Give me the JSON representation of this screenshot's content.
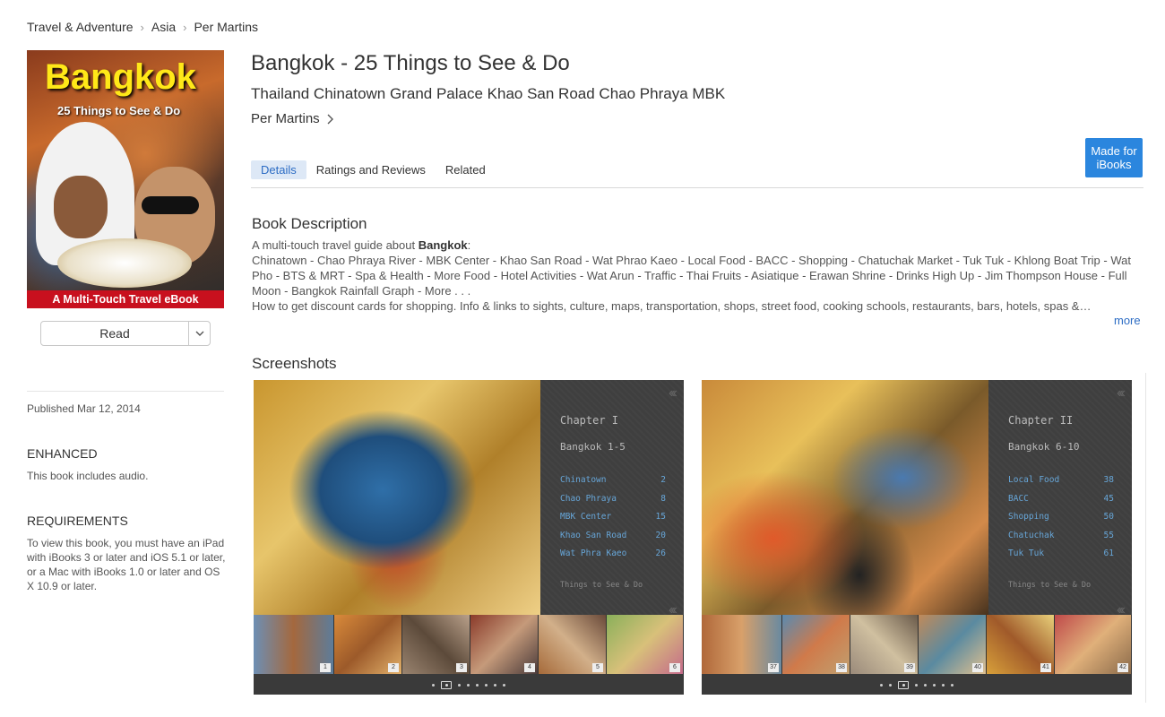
{
  "breadcrumb": [
    "Travel & Adventure",
    "Asia",
    "Per Martins"
  ],
  "cover": {
    "title": "Bangkok",
    "subtitle": "25 Things to See & Do",
    "banner": "A Multi-Touch Travel eBook"
  },
  "read_button": {
    "label": "Read",
    "icon": "chevron-down-icon"
  },
  "sidebar": {
    "published": "Published Mar 12, 2014",
    "enhanced_heading": "ENHANCED",
    "enhanced_text": "This book includes audio.",
    "requirements_heading": "REQUIREMENTS",
    "requirements_text": "To view this book, you must have an iPad with iBooks 3 or later and iOS 5.1 or later, or a Mac with iBooks 1.0 or later and OS X 10.9 or later."
  },
  "book": {
    "title": "Bangkok - 25 Things to See & Do",
    "subtitle": "Thailand Chinatown Grand Palace Khao San Road Chao Phraya MBK",
    "author": "Per Martins"
  },
  "badge": {
    "line1": "Made for",
    "line2": "iBooks"
  },
  "tabs": [
    {
      "label": "Details",
      "active": true
    },
    {
      "label": "Ratings and Reviews",
      "active": false
    },
    {
      "label": "Related",
      "active": false
    }
  ],
  "description": {
    "heading": "Book Description",
    "intro_prefix": "A multi-touch travel guide about ",
    "intro_bold": "Bangkok",
    "intro_suffix": ":",
    "body": "Chinatown - Chao Phraya River - MBK Center - Khao San Road - Wat Phrao Kaeo - Local Food - BACC - Shopping - Chatuchak Market - Tuk Tuk - Khlong Boat Trip - Wat Pho - BTS & MRT - Spa & Health - More Food - Hotel Activities - Wat Arun - Traffic - Thai Fruits - Asiatique - Erawan Shrine - Drinks High Up - Jim Thompson House - Full Moon - Bangkok Rainfall Graph - More . . .",
    "body2": "How to get discount cards for shopping. Info & links to sights, culture, maps, transportation, shops, street food, cooking schools, restaurants, bars, hotels, spas &…",
    "more": "more"
  },
  "screenshots": {
    "heading": "Screenshots",
    "items": [
      {
        "chapter": "Chapter I",
        "range": "Bangkok 1-5",
        "toc": [
          {
            "name": "Chinatown",
            "page": "2"
          },
          {
            "name": "Chao Phraya",
            "page": "8"
          },
          {
            "name": "MBK Center",
            "page": "15"
          },
          {
            "name": "Khao San Road",
            "page": "20"
          },
          {
            "name": "Wat Phra Kaeo",
            "page": "26"
          }
        ],
        "footer": "Things to See & Do",
        "thumb_pages": [
          "1",
          "2",
          "3",
          "4",
          "5",
          "6"
        ]
      },
      {
        "chapter": "Chapter II",
        "range": "Bangkok 6-10",
        "toc": [
          {
            "name": "Local Food",
            "page": "38"
          },
          {
            "name": "BACC",
            "page": "45"
          },
          {
            "name": "Shopping",
            "page": "50"
          },
          {
            "name": "Chatuchak",
            "page": "55"
          },
          {
            "name": "Tuk Tuk",
            "page": "61"
          }
        ],
        "footer": "Things to See & Do",
        "thumb_pages": [
          "37",
          "38",
          "39",
          "40",
          "41",
          "42"
        ]
      }
    ]
  },
  "colors": {
    "accent": "#2c6cc4",
    "badge": "#2b86de",
    "banner_red": "#c8101e",
    "cover_title": "#ffe818"
  }
}
